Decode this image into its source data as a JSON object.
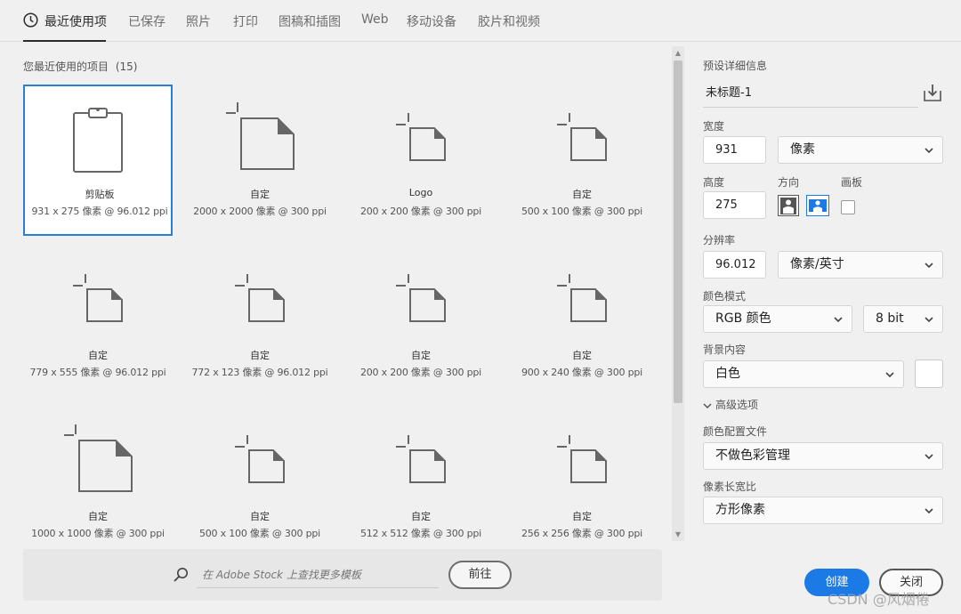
{
  "tabs": [
    {
      "label": "最近使用项",
      "active": true
    },
    {
      "label": "已保存"
    },
    {
      "label": "照片"
    },
    {
      "label": "打印"
    },
    {
      "label": "图稿和插图"
    },
    {
      "label": "Web"
    },
    {
      "label": "移动设备"
    },
    {
      "label": "胶片和视频"
    }
  ],
  "recent": {
    "title": "您最近使用的项目",
    "count": "(15)",
    "items": [
      {
        "title": "剪贴板",
        "sub": "931 x 275 像素 @ 96.012 ppi",
        "icon": "clipboard-icon",
        "selected": true
      },
      {
        "title": "自定",
        "sub": "2000 x 2000 像素 @ 300 ppi",
        "icon": "document-size-icon"
      },
      {
        "title": "Logo",
        "sub": "200 x 200 像素 @ 300 ppi",
        "icon": "document-size-icon"
      },
      {
        "title": "自定",
        "sub": "500 x 100 像素 @ 300 ppi",
        "icon": "document-size-icon"
      },
      {
        "title": "自定",
        "sub": "779 x 555 像素 @ 96.012 ppi",
        "icon": "document-size-icon"
      },
      {
        "title": "自定",
        "sub": "772 x 123 像素 @ 96.012 ppi",
        "icon": "document-size-icon"
      },
      {
        "title": "自定",
        "sub": "200 x 200 像素 @ 300 ppi",
        "icon": "document-size-icon"
      },
      {
        "title": "自定",
        "sub": "900 x 240 像素 @ 300 ppi",
        "icon": "document-size-icon"
      },
      {
        "title": "自定",
        "sub": "1000 x 1000 像素 @ 300 ppi",
        "icon": "document-size-icon"
      },
      {
        "title": "自定",
        "sub": "500 x 100 像素 @ 300 ppi",
        "icon": "document-size-icon"
      },
      {
        "title": "自定",
        "sub": "512 x 512 像素 @ 300 ppi",
        "icon": "document-size-icon"
      },
      {
        "title": "自定",
        "sub": "256 x 256 像素 @ 300 ppi",
        "icon": "document-size-icon"
      }
    ]
  },
  "stock": {
    "placeholder": "在 Adobe Stock 上查找更多模板",
    "go_label": "前往"
  },
  "preset": {
    "section_label": "预设详细信息",
    "name": "未标题-1",
    "width_label": "宽度",
    "width_value": "931",
    "width_unit": "像素",
    "height_label": "高度",
    "height_value": "275",
    "orientation_label": "方向",
    "artboard_label": "画板",
    "resolution_label": "分辨率",
    "resolution_value": "96.012",
    "resolution_unit": "像素/英寸",
    "color_mode_label": "颜色模式",
    "color_mode_value": "RGB 颜色",
    "bit_depth_value": "8 bit",
    "background_label": "背景内容",
    "background_value": "白色",
    "background_swatch": "#ffffff",
    "advanced_label": "高级选项",
    "color_profile_label": "颜色配置文件",
    "color_profile_value": "不做色彩管理",
    "pixel_aspect_label": "像素长宽比",
    "pixel_aspect_value": "方形像素"
  },
  "actions": {
    "create_label": "创建",
    "close_label": "关闭"
  },
  "watermark": "CSDN @风烟倦",
  "colors": {
    "accent": "#1b7ae6",
    "selection": "#2a7fd4"
  }
}
